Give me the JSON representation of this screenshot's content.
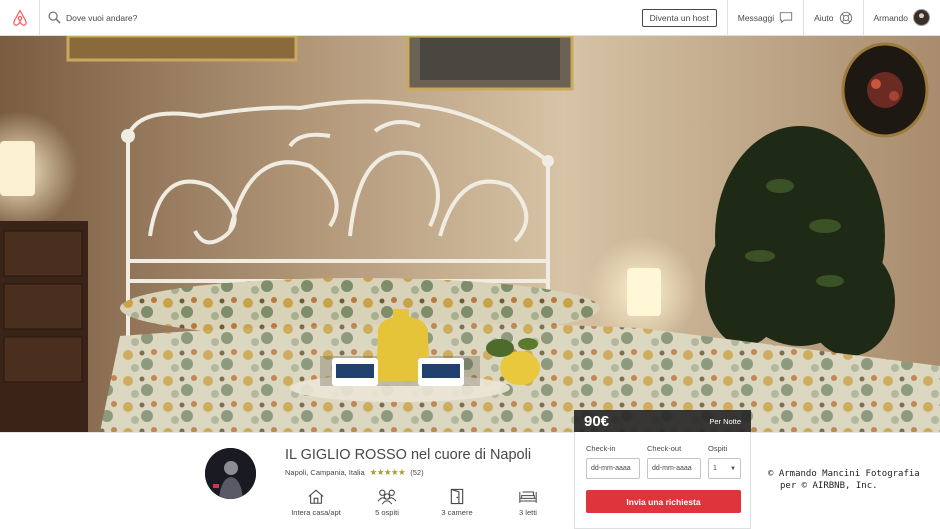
{
  "header": {
    "search_placeholder": "Dove vuoi andare?",
    "host_button": "Diventa un host",
    "messages_label": "Messaggi",
    "help_label": "Aiuto",
    "user_name": "Armando",
    "brand_color": "#ff5a5f"
  },
  "booking": {
    "price": "90€",
    "per_night": "Per Notte",
    "checkin_label": "Check-in",
    "checkout_label": "Check-out",
    "guests_label": "Ospiti",
    "checkin_placeholder": "dd-mm-aaaa",
    "checkout_placeholder": "dd-mm-aaaa",
    "guests_value": "1",
    "request_button": "Invia una richiesta",
    "button_color": "#e0343c"
  },
  "listing": {
    "title": "IL GIGLIO ROSSO nel cuore di Napoli",
    "location": "Napoli, Campania, Italia",
    "rating": 5,
    "review_count": "(52)",
    "amenities": [
      {
        "icon": "house-icon",
        "label": "Intera casa/apt"
      },
      {
        "icon": "guests-icon",
        "label": "5 ospiti"
      },
      {
        "icon": "door-icon",
        "label": "3 camere"
      },
      {
        "icon": "bed-icon",
        "label": "3 letti"
      }
    ]
  },
  "credit": {
    "line1": "© Armando Mancini Fotografia",
    "line2": "per © AIRBNB, Inc."
  }
}
